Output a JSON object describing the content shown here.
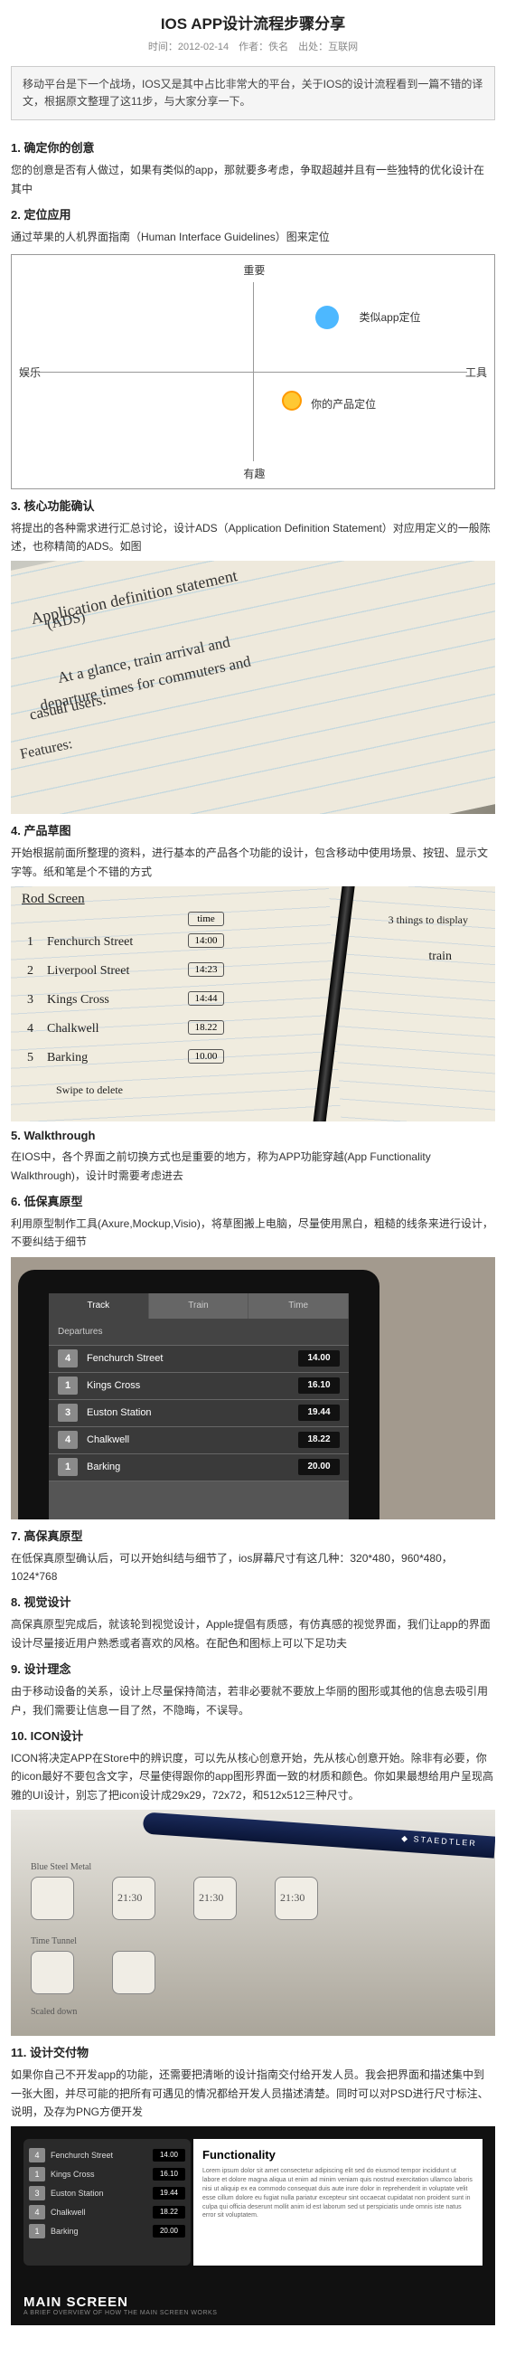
{
  "header": {
    "title": "IOS APP设计流程步骤分享",
    "meta": "时间：2012-02-14　作者：佚名　出处：互联网"
  },
  "intro": "移动平台是下一个战场，IOS又是其中占比非常大的平台，关于IOS的设计流程看到一篇不错的译文，根据原文整理了这11步，与大家分享一下。",
  "s1": {
    "h": "1. 确定你的创意",
    "p": "您的创意是否有人做过，如果有类似的app，那就要多考虑，争取超越并且有一些独特的优化设计在其中"
  },
  "s2": {
    "h": "2. 定位应用",
    "p": "通过苹果的人机界面指南（Human Interface Guidelines）图来定位"
  },
  "quad": {
    "top": "重要",
    "bottom": "有趣",
    "left": "娱乐",
    "right": "工具",
    "blue": "类似app定位",
    "orange": "你的产品定位"
  },
  "s3": {
    "h": "3. 核心功能确认",
    "p": "将提出的各种需求进行汇总讨论，设计ADS（Application Definition Statement）对应用定义的一般陈述，也称精简的ADS。如图"
  },
  "ads": {
    "l1": "Application definition statement",
    "l2": "(ADS)",
    "l3": "At a glance, train arrival and",
    "l4": "departure times for commuters and",
    "l5": "casual users.",
    "l6": "Features:"
  },
  "s4": {
    "h": "4. 产品草图",
    "p": "开始根据前面所整理的资料，进行基本的产品各个功能的设计，包含移动中使用场景、按钮、显示文字等。纸和笔是个不错的方式"
  },
  "sk": {
    "c1": "time",
    "r0": "Rod Screen",
    "r1": "Fenchurch Street",
    "r2": "Liverpool Street",
    "r3": "Kings Cross",
    "r4": "Chalkwell",
    "r5": "Barking",
    "rx": "Swipe to delete",
    "t1": "14:00",
    "t2": "14:23",
    "t3": "14:44",
    "t4": "18.22",
    "t5": "10.00",
    "note1": "3 things to display",
    "note2": "train"
  },
  "s5": {
    "h": "5. Walkthrough",
    "p": "在IOS中，各个界面之前切换方式也是重要的地方，称为APP功能穿越(App Functionality Walkthrough)，设计时需要考虑进去"
  },
  "s6": {
    "h": "6. 低保真原型",
    "p": "利用原型制作工具(Axure,Mockup,Visio)，将草图搬上电脑，尽量使用黑白，粗糙的线条来进行设计，不要纠结于细节"
  },
  "ipad": {
    "t1": "Track",
    "t2": "Train",
    "t3": "Time",
    "dh": "Departures",
    "rows": [
      {
        "n": "4",
        "s": "Fenchurch Street",
        "t": "14.00"
      },
      {
        "n": "1",
        "s": "Kings Cross",
        "t": "16.10"
      },
      {
        "n": "3",
        "s": "Euston Station",
        "t": "19.44"
      },
      {
        "n": "4",
        "s": "Chalkwell",
        "t": "18.22"
      },
      {
        "n": "1",
        "s": "Barking",
        "t": "20.00"
      }
    ]
  },
  "s7": {
    "h": "7. 高保真原型",
    "p": "在低保真原型确认后，可以开始纠结与细节了，ios屏幕尺寸有这几种：320*480，960*480，1024*768"
  },
  "s8": {
    "h": "8. 视觉设计",
    "p": "高保真原型完成后，就该轮到视觉设计，Apple提倡有质感，有仿真感的视觉界面，我们让app的界面设计尽量接近用户熟悉或者喜欢的风格。在配色和图标上可以下足功夫"
  },
  "s9": {
    "h": "9. 设计理念",
    "p": "由于移动设备的关系，设计上尽量保持简洁，若非必要就不要放上华丽的图形或其他的信息去吸引用户，我们需要让信息一目了然，不隐晦，不误导。"
  },
  "s10": {
    "h": "10. ICON设计",
    "p": "ICON将决定APP在Store中的辨识度，可以先从核心创意开始，先从核心创意开始。除非有必要，你的icon最好不要包含文字，尽量使得跟你的app图形界面一致的材质和颜色。你如果最想给用户呈现高雅的UI设计，别忘了把icon设计成29x29，72x72，和512x512三种尺寸。"
  },
  "isk": {
    "a": "Blue Steel Metal",
    "b": "21:30",
    "c": "21:30",
    "d": "21:30",
    "e": "Time Tunnel",
    "f": "Scaled down"
  },
  "s11": {
    "h": "11. 设计交付物",
    "p": "如果你自己不开发app的功能，还需要把清晰的设计指南交付给开发人员。我会把界面和描述集中到一张大图，并尽可能的把所有可遇见的情况都给开发人员描述清楚。同时可以对PSD进行尺寸标注、说明，及存为PNG方便开发"
  },
  "del": {
    "func": "Functionality",
    "ms1": "MAIN SCREEN",
    "ms2": "A BRIEF OVERVIEW OF HOW THE MAIN SCREEN WORKS"
  }
}
